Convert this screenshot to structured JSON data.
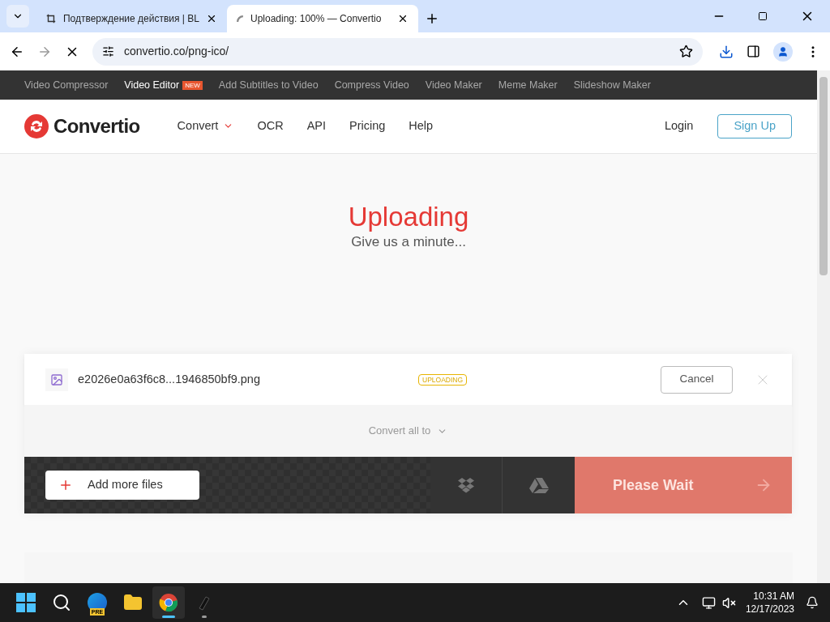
{
  "browser": {
    "tabs": [
      {
        "title": "Подтверждение действия | BL",
        "selected": false,
        "loading": false
      },
      {
        "title": "Uploading: 100% — Convertio",
        "selected": true,
        "loading": true
      }
    ],
    "url": "convertio.co/png-ico/"
  },
  "promo_links": [
    {
      "label": "Video Compressor",
      "highlight": false
    },
    {
      "label": "Video Editor",
      "highlight": true,
      "badge": "NEW"
    },
    {
      "label": "Add Subtitles to Video",
      "highlight": false
    },
    {
      "label": "Compress Video",
      "highlight": false
    },
    {
      "label": "Video Maker",
      "highlight": false
    },
    {
      "label": "Meme Maker",
      "highlight": false
    },
    {
      "label": "Slideshow Maker",
      "highlight": false
    }
  ],
  "header": {
    "logo": "Convertio",
    "nav": [
      {
        "label": "Convert",
        "kind": "dropdown"
      },
      {
        "label": "OCR",
        "kind": "link"
      },
      {
        "label": "API",
        "kind": "link"
      },
      {
        "label": "Pricing",
        "kind": "link"
      },
      {
        "label": "Help",
        "kind": "link"
      }
    ],
    "login": "Login",
    "signup": "Sign Up"
  },
  "hero": {
    "title": "Uploading",
    "subtitle": "Give us a minute..."
  },
  "files": [
    {
      "name": "e2026e0a63f6c8...1946850bf9.png",
      "status": "UPLOADING",
      "action": "Cancel"
    }
  ],
  "convert_all": "Convert all to",
  "actions": {
    "add_more": "Add more files",
    "primary": "Please Wait",
    "disabled": true
  },
  "taskbar": {
    "apps": [
      {
        "kind": "edge",
        "running": false,
        "selected": false,
        "badge": "PRE"
      },
      {
        "kind": "folder",
        "running": false,
        "selected": false
      },
      {
        "kind": "chrome",
        "running": true,
        "selected": true
      },
      {
        "kind": "pen",
        "running": true,
        "selected": false
      }
    ],
    "time": "10:31 AM",
    "date": "12/17/2023"
  }
}
